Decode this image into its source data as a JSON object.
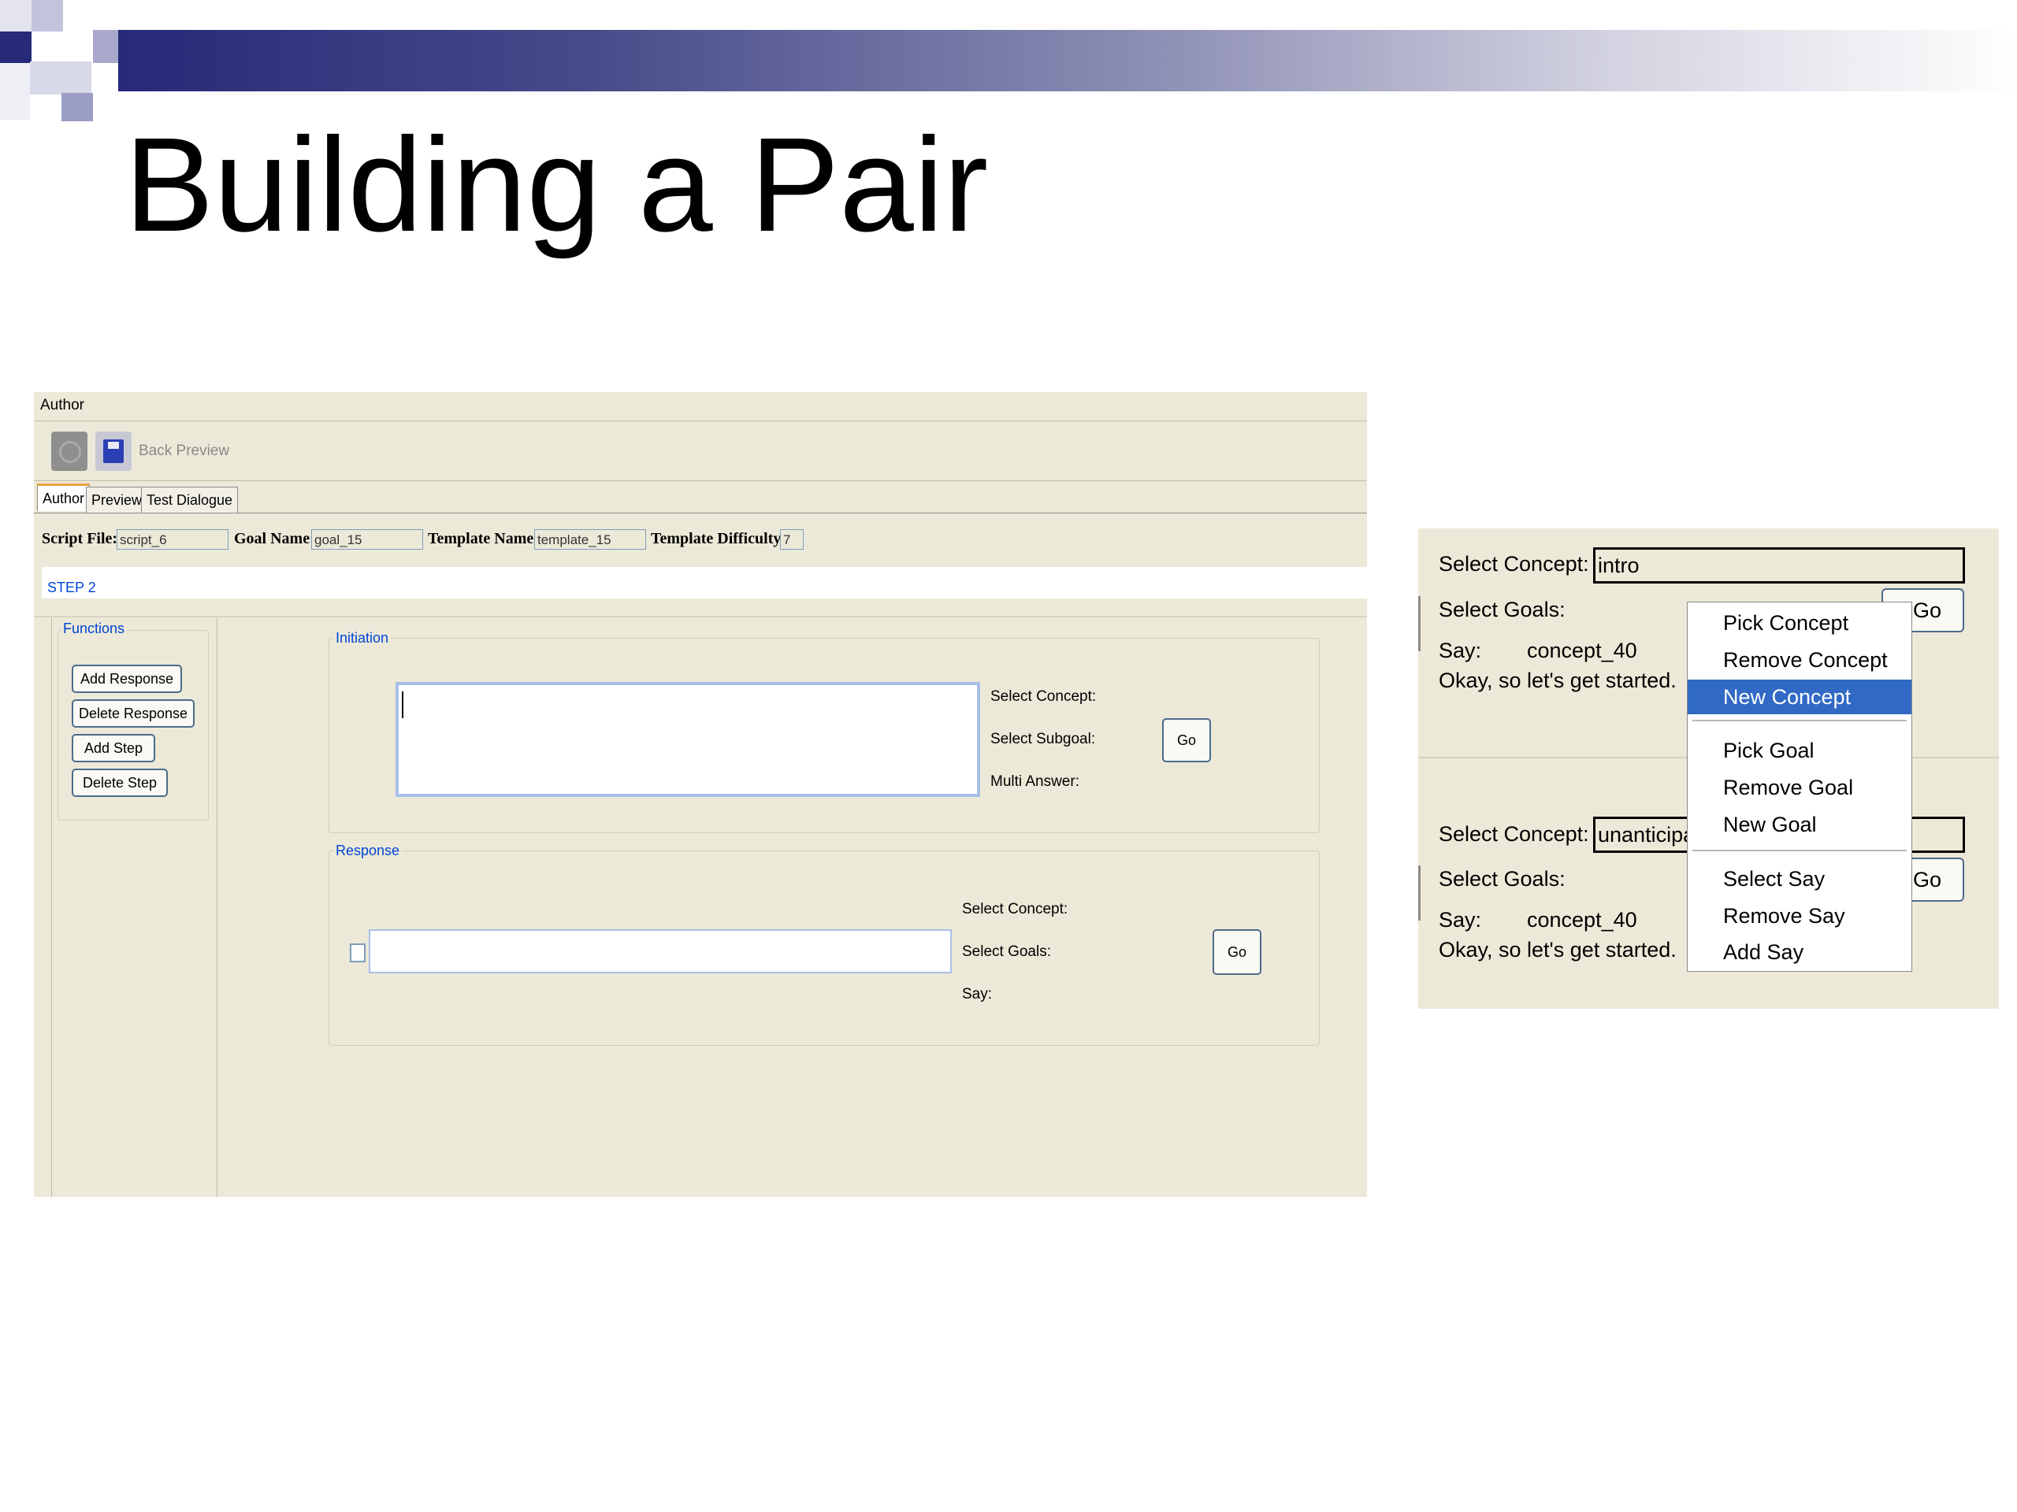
{
  "slide": {
    "title": "Building a Pair"
  },
  "author_window": {
    "window_title": "Author",
    "toolbar": {
      "back_icon": "back-arrow-icon",
      "save_icon": "floppy-disk-icon",
      "back_preview_label": "Back Preview"
    },
    "tabs": [
      {
        "label": "Author",
        "active": true
      },
      {
        "label": "Preview",
        "active": false
      },
      {
        "label": "Test Dialogue",
        "active": false
      }
    ],
    "fields": {
      "script_file_label": "Script File:",
      "script_file_value": "script_6",
      "goal_name_label": "Goal Name:",
      "goal_name_value": "goal_15",
      "template_name_label": "Template Name:",
      "template_name_value": "template_15",
      "template_difficulty_label": "Template Difficulty:",
      "template_difficulty_value": "7"
    },
    "step_label": "STEP 2",
    "functions": {
      "legend": "Functions",
      "buttons": [
        "Add Response",
        "Delete Response",
        "Add Step",
        "Delete Step"
      ]
    },
    "initiation": {
      "legend": "Initiation",
      "select_concept_label": "Select Concept:",
      "select_subgoal_label": "Select Subgoal:",
      "multi_answer_label": "Multi Answer:",
      "go_label": "Go"
    },
    "response": {
      "legend": "Response",
      "select_concept_label": "Select Concept:",
      "select_goals_label": "Select Goals:",
      "say_label": "Say:",
      "go_label": "Go"
    }
  },
  "concept_panel": {
    "top": {
      "select_concept_label": "Select Concept:",
      "select_concept_value": "intro",
      "select_goals_label": "Select Goals:",
      "say_label": "Say:",
      "say_value": "concept_40",
      "say_text": "Okay, so let's get started.",
      "go_label": "Go"
    },
    "bottom": {
      "select_concept_label": "Select Concept:",
      "select_concept_value": "unanticipa",
      "select_goals_label": "Select Goals:",
      "say_label": "Say:",
      "say_value": "concept_40",
      "say_text": "Okay, so let's get started.",
      "go_label": "Go"
    },
    "context_menu": {
      "items": [
        "Pick Concept",
        "Remove Concept",
        "New Concept",
        "Pick Goal",
        "Remove Goal",
        "New Goal",
        "Select Say",
        "Remove Say",
        "Add Say"
      ],
      "highlighted": "New Concept",
      "highlight_color": "#316ac5"
    }
  }
}
